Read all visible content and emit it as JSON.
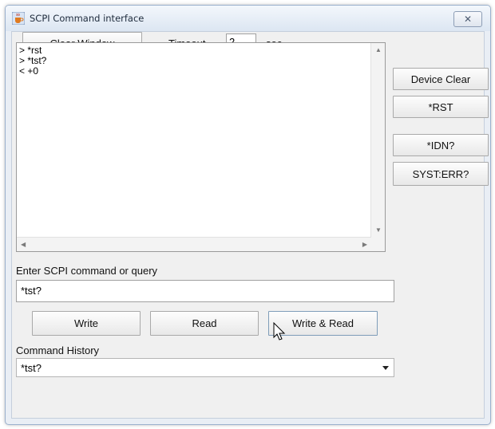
{
  "window": {
    "title": "SCPI Command interface",
    "close_glyph": "✕"
  },
  "toolbar": {
    "clear_label": "Clear Window",
    "timeout_label": "Timeout",
    "timeout_value": "2",
    "timeout_unit": "sec"
  },
  "output": {
    "lines": [
      "> *rst",
      "> *tst?",
      "< +0"
    ]
  },
  "side_buttons": {
    "device_clear": "Device Clear",
    "rst": "*RST",
    "idn": "*IDN?",
    "syst_err": "SYST:ERR?"
  },
  "command": {
    "label": "Enter SCPI command or query",
    "value": "*tst?"
  },
  "actions": {
    "write": "Write",
    "read": "Read",
    "write_read": "Write & Read"
  },
  "history": {
    "label": "Command History",
    "selected": "*tst?"
  },
  "icons": {
    "app": "java-cup-icon",
    "close": "close-icon",
    "dropdown": "chevron-down-icon",
    "cursor": "mouse-pointer-icon"
  }
}
